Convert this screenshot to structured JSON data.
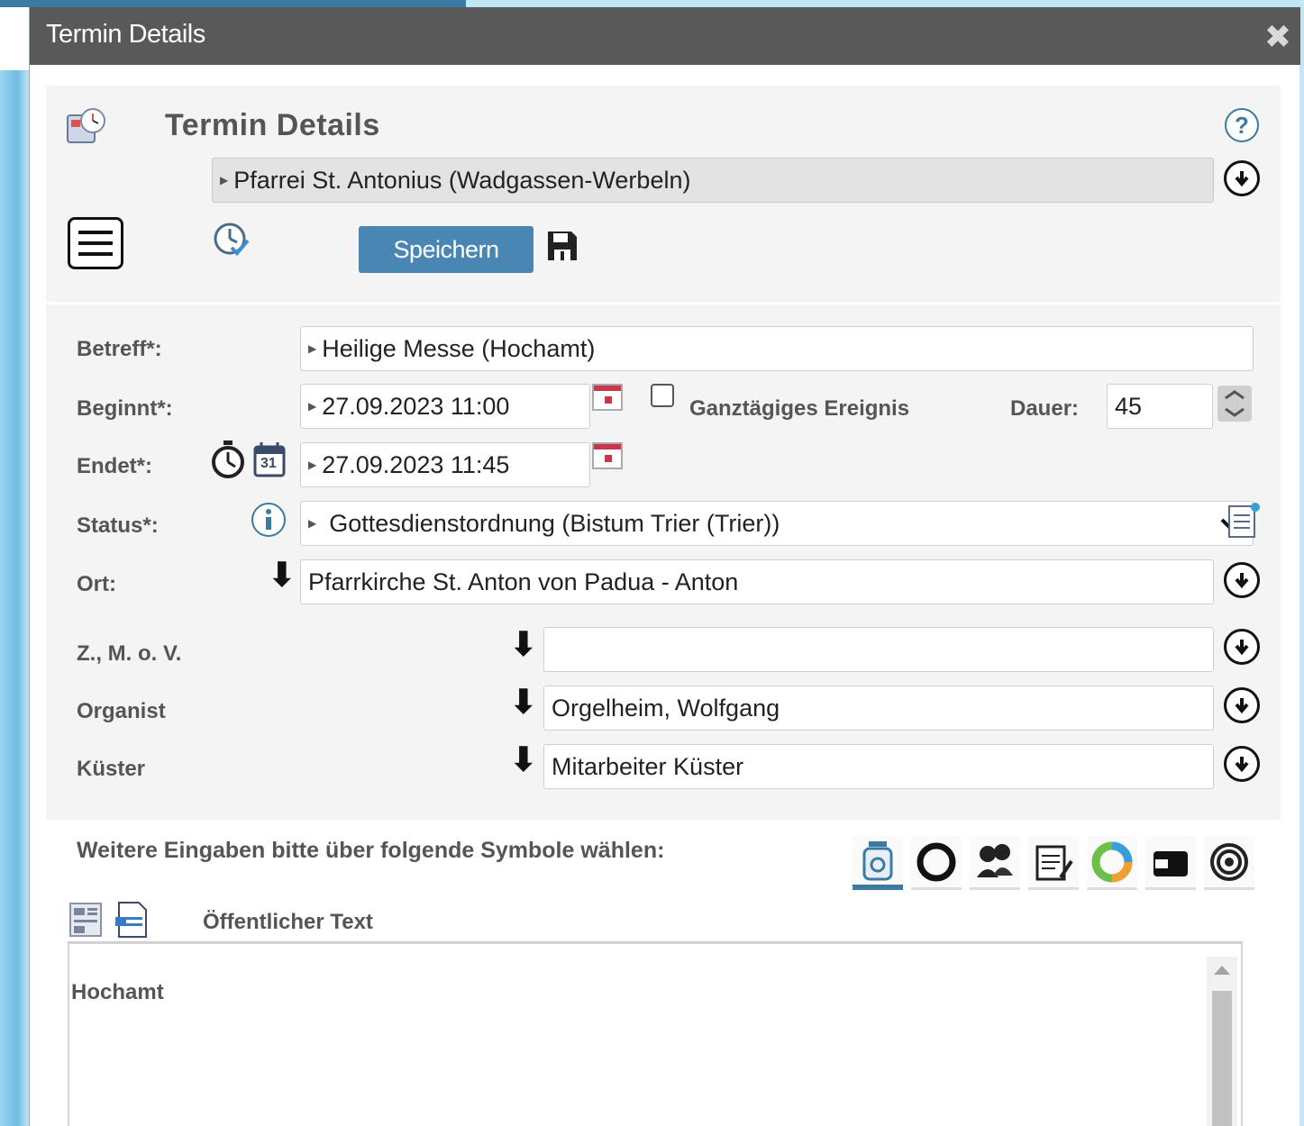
{
  "dialog": {
    "title": "Termin Details",
    "close_glyph": "✖"
  },
  "header": {
    "title": "Termin Details",
    "parish": "Pfarrei St. Antonius (Wadgassen-Werbeln)",
    "save_label": "Speichern",
    "help_glyph": "?"
  },
  "form": {
    "subject": {
      "label": "Betreff*:",
      "value": "Heilige Messe (Hochamt)"
    },
    "begin": {
      "label": "Beginnt*:",
      "value": "27.09.2023 11:00"
    },
    "allday": {
      "label": "Ganztägiges Ereignis",
      "checked": false
    },
    "duration": {
      "label": "Dauer:",
      "value": "45"
    },
    "end": {
      "label": "Endet*:",
      "value": "27.09.2023 11:45",
      "cal_day": "31"
    },
    "status": {
      "label": "Status*:",
      "value": "Gottesdienstordnung (Bistum Trier (Trier))"
    },
    "location": {
      "label": "Ort:",
      "value": "Pfarrkirche St. Anton von Padua - Anton"
    },
    "zmov": {
      "label": "Z., M. o. V.",
      "value": ""
    },
    "organist": {
      "label": "Organist",
      "value": "Orgelheim, Wolfgang"
    },
    "sacristan": {
      "label": "Küster",
      "value": "Mitarbeiter Küster"
    }
  },
  "more": {
    "prompt": "Weitere Eingaben bitte über folgende Symbole wählen:",
    "tabs": [
      "jar-icon",
      "recycle-icon",
      "people-icon",
      "notepad-icon",
      "pie-icon",
      "wallet-icon",
      "target-icon"
    ]
  },
  "text_section": {
    "title": "Öffentlicher Text",
    "content": "Hochamt"
  }
}
